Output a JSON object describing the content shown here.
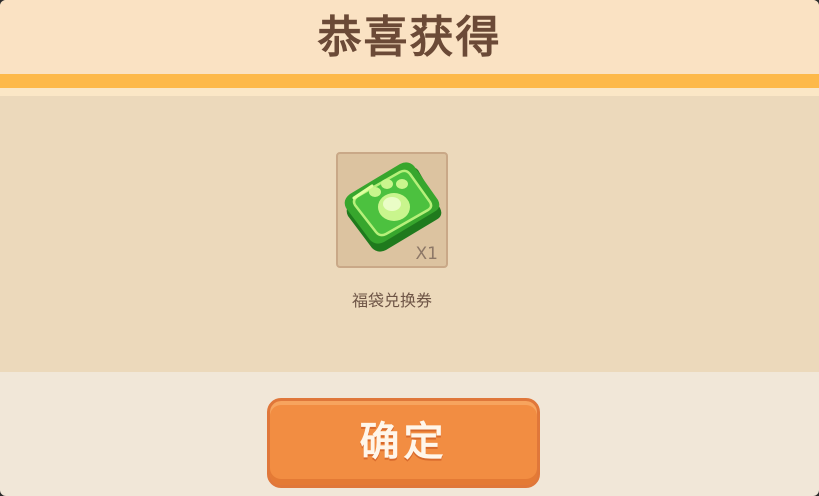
{
  "dialog": {
    "title": "恭喜获得"
  },
  "reward": {
    "icon": "green-paw-voucher-icon",
    "quantity": "X1",
    "name": "福袋兑换券"
  },
  "confirm_button": {
    "label": "确定"
  },
  "colors": {
    "header_bg": "#fae2c3",
    "header_stripe": "#fdb94a",
    "panel_bg": "#ecd9bb",
    "dialog_bg": "#f1e7d8",
    "button_bg": "#f28d42",
    "title_text": "#6b4a37"
  }
}
